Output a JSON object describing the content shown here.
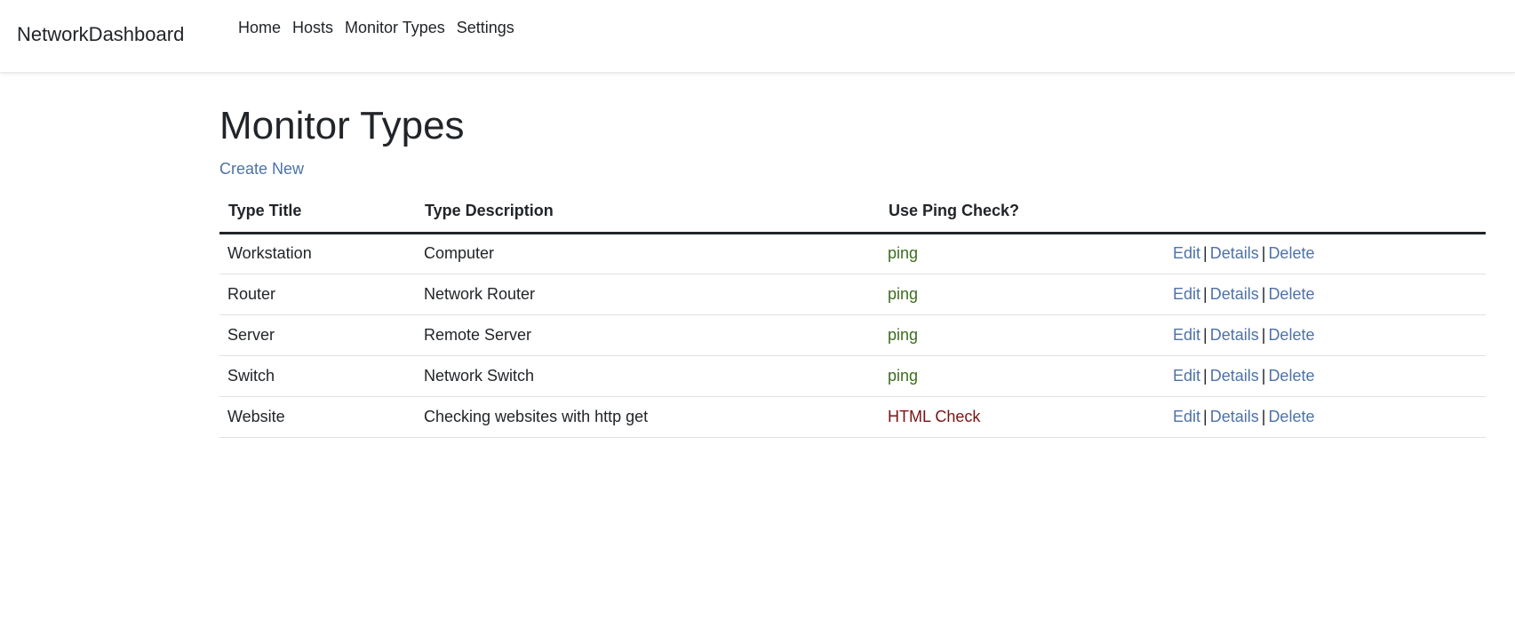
{
  "nav": {
    "brand": "NetworkDashboard",
    "links": [
      "Home",
      "Hosts",
      "Monitor Types",
      "Settings"
    ]
  },
  "page": {
    "title": "Monitor Types",
    "create_label": "Create New"
  },
  "table": {
    "headers": [
      "Type Title",
      "Type Description",
      "Use Ping Check?",
      ""
    ],
    "actions": {
      "edit": "Edit",
      "details": "Details",
      "delete": "Delete",
      "separator": "|"
    },
    "rows": [
      {
        "title": "Workstation",
        "description": "Computer",
        "check": "ping",
        "check_kind": "ok"
      },
      {
        "title": "Router",
        "description": "Network Router",
        "check": "ping",
        "check_kind": "ok"
      },
      {
        "title": "Server",
        "description": "Remote Server",
        "check": "ping",
        "check_kind": "ok"
      },
      {
        "title": "Switch",
        "description": "Network Switch",
        "check": "ping",
        "check_kind": "ok"
      },
      {
        "title": "Website",
        "description": "Checking websites with http get",
        "check": "HTML Check",
        "check_kind": "warn"
      }
    ]
  },
  "colors": {
    "link": "#4e72a8",
    "ok": "#3d6d1e",
    "warn": "#7a1416",
    "text": "#212529"
  }
}
